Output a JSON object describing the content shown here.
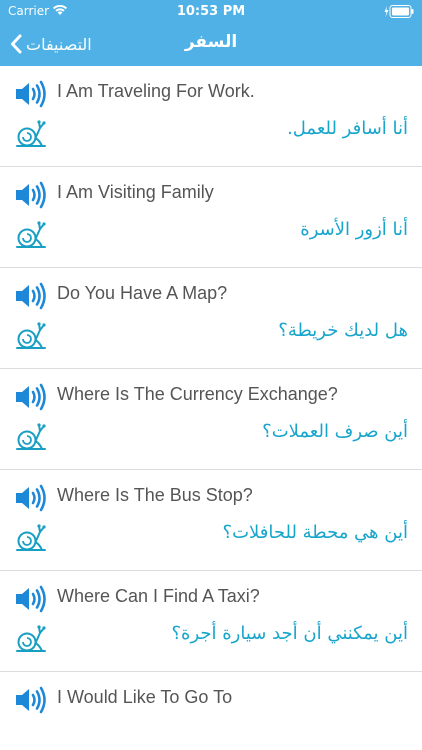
{
  "status_bar": {
    "carrier": "Carrier",
    "time": "10:53 PM"
  },
  "nav": {
    "back_label": "التصنيفات",
    "title": "السفر"
  },
  "phrases": [
    {
      "english": "I Am Traveling For Work.",
      "arabic": "أنا أسافر للعمل."
    },
    {
      "english": "I Am Visiting Family",
      "arabic": "أنا أزور الأسرة"
    },
    {
      "english": "Do You Have A Map?",
      "arabic": "هل لديك خريطة؟"
    },
    {
      "english": "Where Is The Currency Exchange?",
      "arabic": "أين صرف العملات؟"
    },
    {
      "english": "Where Is The Bus Stop?",
      "arabic": "أين هي محطة للحافلات؟"
    },
    {
      "english": "Where Can I Find A Taxi?",
      "arabic": "أين يمكنني أن أجد سيارة أجرة؟"
    },
    {
      "english": "I Would Like To Go To",
      "arabic": ""
    }
  ],
  "colors": {
    "header": "#4fb1e6",
    "arabic_text": "#17a5cc",
    "speaker_icon": "#1e88d8",
    "snail_icon": "#1a9fc4"
  },
  "icons": {
    "speaker": "speaker-icon",
    "snail": "snail-icon",
    "back": "chevron-left-icon"
  }
}
